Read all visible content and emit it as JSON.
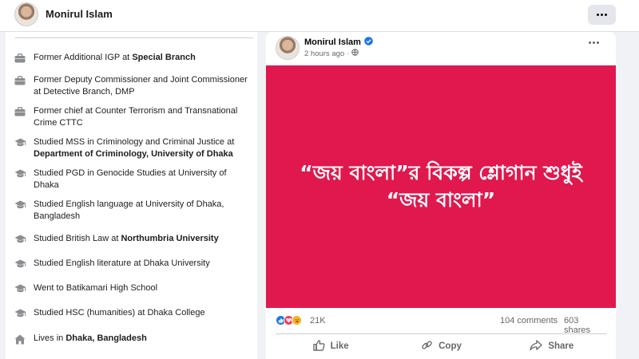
{
  "header": {
    "profile_name": "Monirul Islam",
    "more_icon": "more-dots-icon"
  },
  "intro": {
    "items": [
      {
        "icon": "briefcase-icon",
        "text": "Former Additional IGP at ",
        "bold": "Special Branch"
      },
      {
        "icon": "briefcase-icon",
        "text": "Former Deputy Commissioner and Joint Commissioner at Detective Branch, DMP",
        "bold": ""
      },
      {
        "icon": "briefcase-icon",
        "text": "Former chief at Counter Terrorism and Transnational Crime CTTC",
        "bold": ""
      },
      {
        "icon": "graduation-cap-icon",
        "text": "Studied MSS in Criminology and Criminal Justice at ",
        "bold": "Department of Criminology, University of Dhaka"
      },
      {
        "icon": "graduation-cap-icon",
        "text": "Studied PGD in Genocide Studies at University of Dhaka",
        "bold": ""
      },
      {
        "icon": "graduation-cap-icon",
        "text": "Studied English language at University of Dhaka, Bangladesh",
        "bold": ""
      },
      {
        "icon": "graduation-cap-icon",
        "text": "Studied British Law at ",
        "bold": "Northumbria University"
      },
      {
        "icon": "graduation-cap-icon",
        "text": "Studied English literature at Dhaka University",
        "bold": ""
      },
      {
        "icon": "graduation-cap-icon",
        "text": "Went to Batikamari High School",
        "bold": ""
      },
      {
        "icon": "graduation-cap-icon",
        "text": "Studied HSC (humanities) at Dhaka College",
        "bold": ""
      },
      {
        "icon": "home-icon",
        "text": "Lives in ",
        "bold": "Dhaka, Bangladesh"
      }
    ]
  },
  "post": {
    "author": "Monirul Islam",
    "time": "2 hours ago",
    "quote_line1": "“জয় বাংলা”র বিকল্প শ্লোগান শুধুই",
    "quote_line2": "“জয় বাংলা”",
    "image_bg": "#e0184d",
    "reaction_count": "21K",
    "comments": "104 comments",
    "shares": "603 shares",
    "actions": {
      "like": "Like",
      "copy": "Copy",
      "share": "Share"
    }
  },
  "colors": {
    "accent": "#1877f2",
    "secondary_text": "#65676b"
  }
}
